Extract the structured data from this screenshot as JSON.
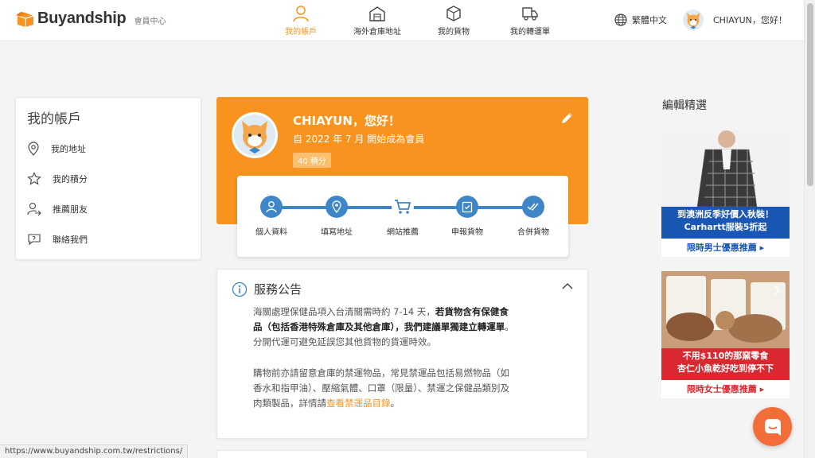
{
  "header": {
    "logo_text": "Buyandship",
    "logo_sub": "會員中心",
    "nav": [
      {
        "label": "我的帳戶",
        "icon": "user-icon",
        "active": true
      },
      {
        "label": "海外倉庫地址",
        "icon": "warehouse-icon",
        "active": false
      },
      {
        "label": "我的貨物",
        "icon": "package-icon",
        "active": false
      },
      {
        "label": "我的轉運單",
        "icon": "truck-icon",
        "active": false
      }
    ],
    "language": "繁體中文",
    "greeting": "CHIAYUN，您好！"
  },
  "sidebar": {
    "title": "我的帳戶",
    "items": [
      {
        "label": "我的地址",
        "icon": "location-icon"
      },
      {
        "label": "我的積分",
        "icon": "star-icon"
      },
      {
        "label": "推薦朋友",
        "icon": "refer-user-icon"
      },
      {
        "label": "聯絡我們",
        "icon": "chat-bubble-icon"
      }
    ]
  },
  "profile": {
    "name": "CHIAYUN，您好！",
    "since": "自 2022 年 7 月 開始成為會員",
    "points": "40 積分"
  },
  "steps": [
    {
      "label": "個人資料",
      "icon": "user-icon"
    },
    {
      "label": "填寫地址",
      "icon": "location-icon"
    },
    {
      "label": "網站推薦",
      "icon": "cart-icon"
    },
    {
      "label": "申報貨物",
      "icon": "clipboard-check-icon"
    },
    {
      "label": "合併貨物",
      "icon": "double-check-icon"
    }
  ],
  "notice": {
    "title": "服務公告",
    "p1_a": "海關處理保健品項入台清關需時約 7-14 天，",
    "p1_b": "若貨物含有保健食品（包括香港特殊倉庫及其他倉庫），我們建議單獨建立轉運單",
    "p1_c": "。分開代運可避免延誤您其他貨物的貨運時效。",
    "p2_a": "購物前亦請留意倉庫的禁運物品，常見禁運品包括易燃物品（如香水和指甲油）、壓縮氣體、口罩（限量）、禁運之保健品類別及肉類製品，詳情請",
    "p2_link": "查看禁運品目錄",
    "p2_b": "。"
  },
  "rail": {
    "title": "編輯精選",
    "ads": [
      {
        "line1": "到澳洲反季好價入秋裝！",
        "line2": "Carhartt服裝5折起",
        "cta": "限時男士優惠推薦 ▸"
      },
      {
        "line1": "不用$110的那窯零食",
        "line2": "杏仁小魚乾好吃到停不下",
        "cta": "限時女士優惠推薦 ▸"
      }
    ]
  },
  "statusbar": "https://www.buyandship.com.tw/restrictions/",
  "colors": {
    "accent": "#f7931e",
    "step_blue": "#3f86c8",
    "chat": "#f26d38"
  }
}
